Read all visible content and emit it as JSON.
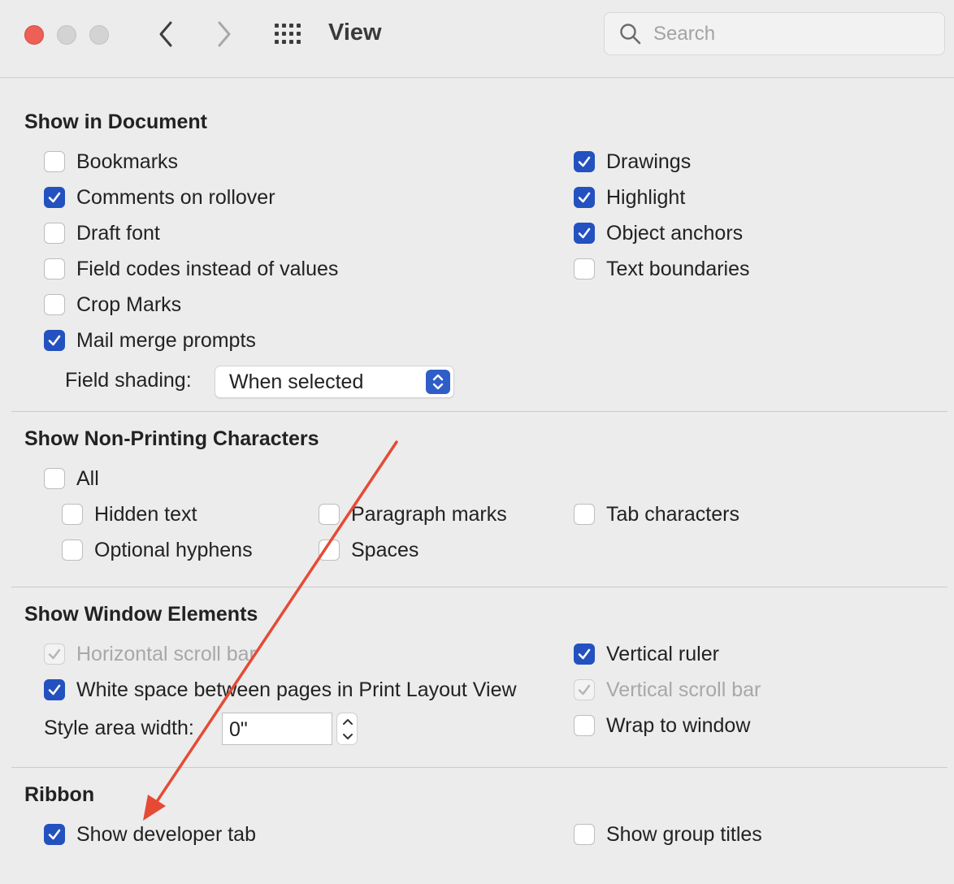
{
  "window": {
    "title": "View"
  },
  "search": {
    "placeholder": "Search"
  },
  "sections": {
    "document": {
      "title": "Show in Document",
      "bookmarks": "Bookmarks",
      "comments": "Comments on rollover",
      "draft_font": "Draft font",
      "field_codes": "Field codes instead of values",
      "crop_marks": "Crop Marks",
      "mail_merge": "Mail merge prompts",
      "drawings": "Drawings",
      "highlight": "Highlight",
      "object_anchors": "Object anchors",
      "text_boundaries": "Text boundaries",
      "field_shading_label": "Field shading:",
      "field_shading_value": "When selected"
    },
    "nonprinting": {
      "title": "Show Non-Printing Characters",
      "all": "All",
      "hidden_text": "Hidden text",
      "optional_hyphens": "Optional hyphens",
      "paragraph_marks": "Paragraph marks",
      "spaces": "Spaces",
      "tab_characters": "Tab characters"
    },
    "window_elements": {
      "title": "Show Window Elements",
      "horizontal_scroll": "Horizontal scroll bar",
      "white_space": "White space between pages in Print Layout View",
      "style_area_label": "Style area width:",
      "style_area_value": "0\"",
      "vertical_ruler": "Vertical ruler",
      "vertical_scroll": "Vertical scroll bar",
      "wrap_to_window": "Wrap to window"
    },
    "ribbon": {
      "title": "Ribbon",
      "developer_tab": "Show developer tab",
      "group_titles": "Show group titles"
    }
  },
  "colors": {
    "accent": "#2351bf",
    "annotation_arrow": "#e64a35"
  }
}
